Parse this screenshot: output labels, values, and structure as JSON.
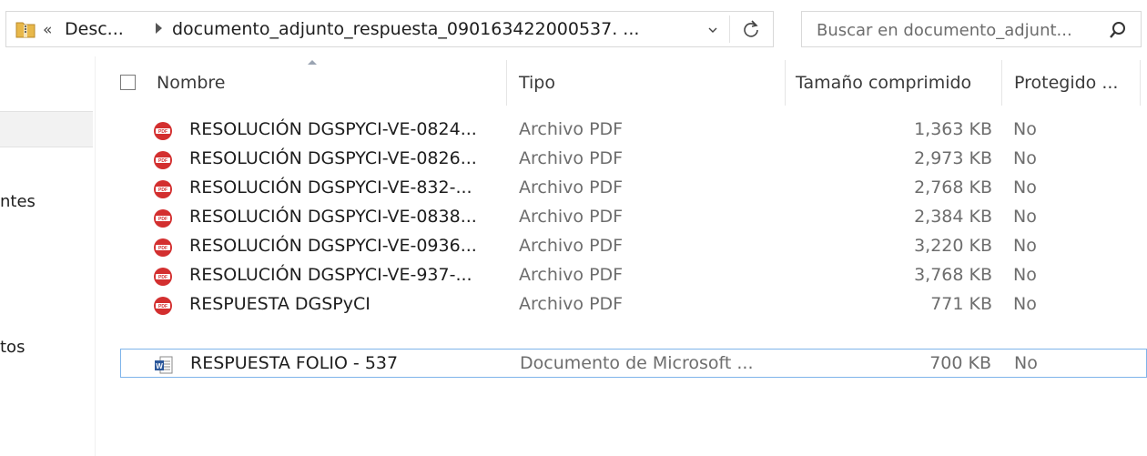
{
  "address_bar": {
    "overflow_chevron": "«",
    "crumbs": [
      "Desc...",
      "documento_adjunto_respuesta_090163422000537. ..."
    ]
  },
  "search": {
    "placeholder": "Buscar en documento_adjunt..."
  },
  "nav_pane": {
    "items": [
      "ntes",
      "tos"
    ]
  },
  "columns": {
    "name": "Nombre",
    "type": "Tipo",
    "compressed_size": "Tamaño comprimido",
    "protected": "Protegido ..."
  },
  "files": [
    {
      "name": "RESOLUCIÓN DGSPYCI-VE-0824...",
      "type": "Archivo PDF",
      "size": "1,363 KB",
      "protected": "No",
      "icon": "pdf-icon"
    },
    {
      "name": "RESOLUCIÓN DGSPYCI-VE-0826...",
      "type": "Archivo PDF",
      "size": "2,973 KB",
      "protected": "No",
      "icon": "pdf-icon"
    },
    {
      "name": "RESOLUCIÓN DGSPYCI-VE-832-...",
      "type": "Archivo PDF",
      "size": "2,768 KB",
      "protected": "No",
      "icon": "pdf-icon"
    },
    {
      "name": "RESOLUCIÓN DGSPYCI-VE-0838...",
      "type": "Archivo PDF",
      "size": "2,384 KB",
      "protected": "No",
      "icon": "pdf-icon"
    },
    {
      "name": "RESOLUCIÓN DGSPYCI-VE-0936...",
      "type": "Archivo PDF",
      "size": "3,220 KB",
      "protected": "No",
      "icon": "pdf-icon"
    },
    {
      "name": "RESOLUCIÓN DGSPYCI-VE-937-...",
      "type": "Archivo PDF",
      "size": "3,768 KB",
      "protected": "No",
      "icon": "pdf-icon"
    },
    {
      "name": "RESPUESTA DGSPyCI",
      "type": "Archivo PDF",
      "size": "771 KB",
      "protected": "No",
      "icon": "pdf-icon"
    },
    {
      "name": "RESPUESTA FOLIO - 537",
      "type": "Documento de Microsoft ...",
      "size": "700 KB",
      "protected": "No",
      "icon": "word-doc-icon",
      "selected": true
    }
  ],
  "colors": {
    "selection_border": "#7eb4ea",
    "pdf_red": "#d32f2f",
    "word_blue": "#2b579a"
  }
}
